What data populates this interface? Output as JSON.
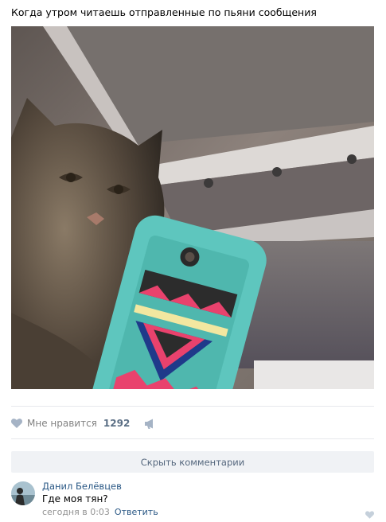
{
  "post": {
    "text": "Когда утром читаешь отправленные по пьяни сообщения"
  },
  "actions": {
    "like_label": "Мне нравится",
    "like_count": "1292"
  },
  "comments_toggle": {
    "label": "Скрыть комментарии"
  },
  "comment": {
    "author": "Данил Белёвцев",
    "text": "Где моя тян?",
    "time": "сегодня в 0:03",
    "reply_label": "Ответить"
  },
  "colors": {
    "link": "#2a5885",
    "muted": "#828282",
    "like_icon": "#a5b3c5",
    "button_bg": "#f0f2f5",
    "phone_case": "#5ec6be"
  },
  "icons": {
    "like": "heart-icon",
    "share": "megaphone-icon",
    "comment_like": "heart-icon"
  }
}
